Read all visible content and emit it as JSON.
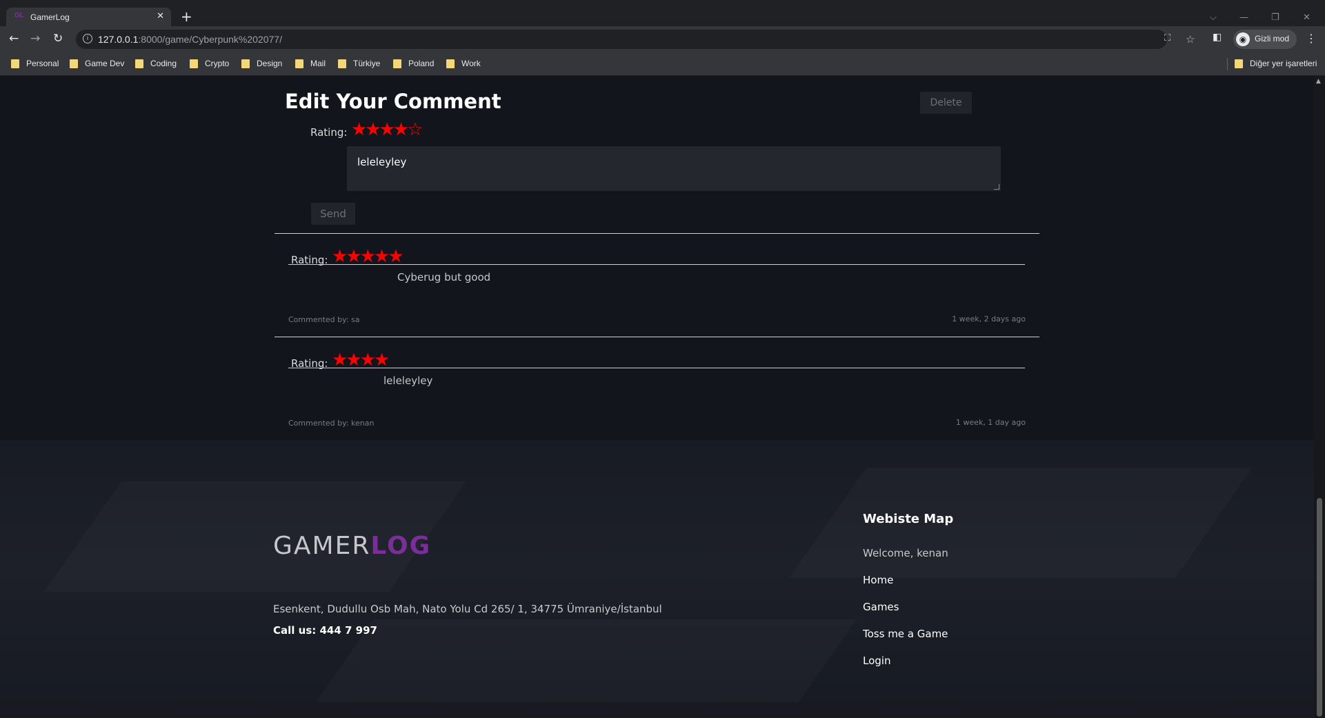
{
  "browser": {
    "tab_title": "GamerLog",
    "tab_favicon": "GL",
    "tab_close": "✕",
    "new_tab": "+",
    "url_host": "127.0.0.1",
    "url_rest": ":8000/game/Cyberpunk%202077/",
    "profile_label": "Gizli mod",
    "other_bookmarks": "Diğer yer işaretleri",
    "bookmarks": [
      "Personal",
      "Game Dev",
      "Coding",
      "Crypto",
      "Design",
      "Mail",
      "Türkiye",
      "Poland",
      "Work"
    ]
  },
  "edit": {
    "title": "Edit Your Comment",
    "delete_label": "Delete",
    "rating_label": "Rating:",
    "rating_stars": "★★★★☆",
    "rating_value": 4,
    "rating_max": 5,
    "comment_value": "leleleyley",
    "send_label": "Send"
  },
  "comments": [
    {
      "rating_label": "Rating:",
      "stars": "★★★★★",
      "rating_value": 5,
      "text": "Cyberug but good",
      "author": "Commented by: sa",
      "time": "1 week, 2 days ago"
    },
    {
      "rating_label": "Rating:",
      "stars": "★★★★",
      "rating_value": 4,
      "text": "leleleyley",
      "author": "Commented by: kenan",
      "time": "1 week, 1 day ago"
    }
  ],
  "footer": {
    "logo_gamer": "GAMER",
    "logo_log": "LOG",
    "address": "Esenkent, Dudullu Osb Mah, Nato Yolu Cd 265/ 1, 34775 Ümraniye/İstanbul",
    "phone": "Call us: 444 7 997",
    "map_title": "Webiste Map",
    "welcome": "Welcome, kenan",
    "links": [
      "Home",
      "Games",
      "Toss me a Game",
      "Login"
    ]
  },
  "colors": {
    "accent_purple": "#7a2e9a",
    "star_red": "#ff0000",
    "page_bg": "#13151d"
  }
}
